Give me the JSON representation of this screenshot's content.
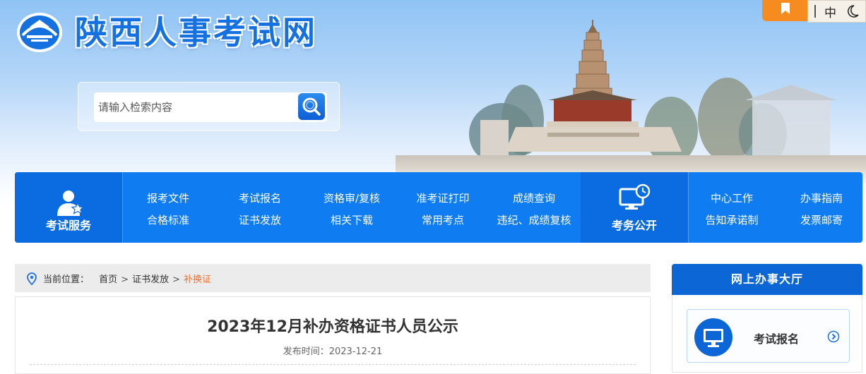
{
  "site": {
    "title": "陕西人事考试网"
  },
  "search": {
    "placeholder": "请输入检索内容"
  },
  "lang": {
    "label": "中"
  },
  "nav": {
    "exam_service": "考试服务",
    "exam_public": "考务公开",
    "links_row1": [
      "报考文件",
      "考试报名",
      "资格审/复核",
      "准考证打印",
      "成绩查询"
    ],
    "links_row2": [
      "合格标准",
      "证书发放",
      "相关下载",
      "常用考点",
      "违纪、成绩复核"
    ],
    "right_row1": [
      "中心工作",
      "办事指南"
    ],
    "right_row2": [
      "告知承诺制",
      "发票邮寄"
    ]
  },
  "breadcrumb": {
    "prefix": "当前位置：",
    "items": [
      "首页",
      "证书发放"
    ],
    "current": "补换证",
    "separator": ">"
  },
  "article": {
    "title": "2023年12月补办资格证书人员公示",
    "date_label": "发布时间：",
    "date": "2023-12-21"
  },
  "side": {
    "title": "网上办事大厅",
    "card_label": "考试报名"
  },
  "colors": {
    "primary": "#0f7cf2",
    "primary_dark": "#0a6ce0",
    "accent_orange": "#f68b1f",
    "current_crumb": "#f0702a"
  }
}
